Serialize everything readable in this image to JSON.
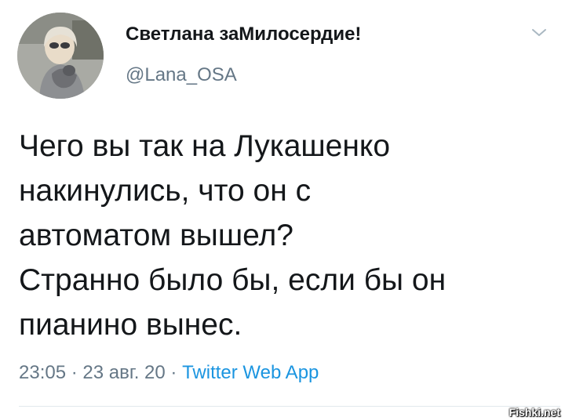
{
  "tweet": {
    "author": {
      "display_name": "Светлана заМилосердие!",
      "handle": "@Lana_OSA"
    },
    "text_lines": [
      "Чего вы так на Лукашенко",
      "накинулись, что он с",
      "автоматом вышел?",
      "Странно было бы, если бы он",
      "пианино вынес."
    ],
    "meta": {
      "time": "23:05",
      "separator": "·",
      "date": "23 авг. 20",
      "source": "Twitter Web App"
    },
    "more_icon": "chevron-down-icon"
  },
  "watermark": "Fishki.net",
  "colors": {
    "text": "#14171a",
    "secondary": "#657786",
    "link": "#1b95e0",
    "divider": "#e1e8ed"
  }
}
